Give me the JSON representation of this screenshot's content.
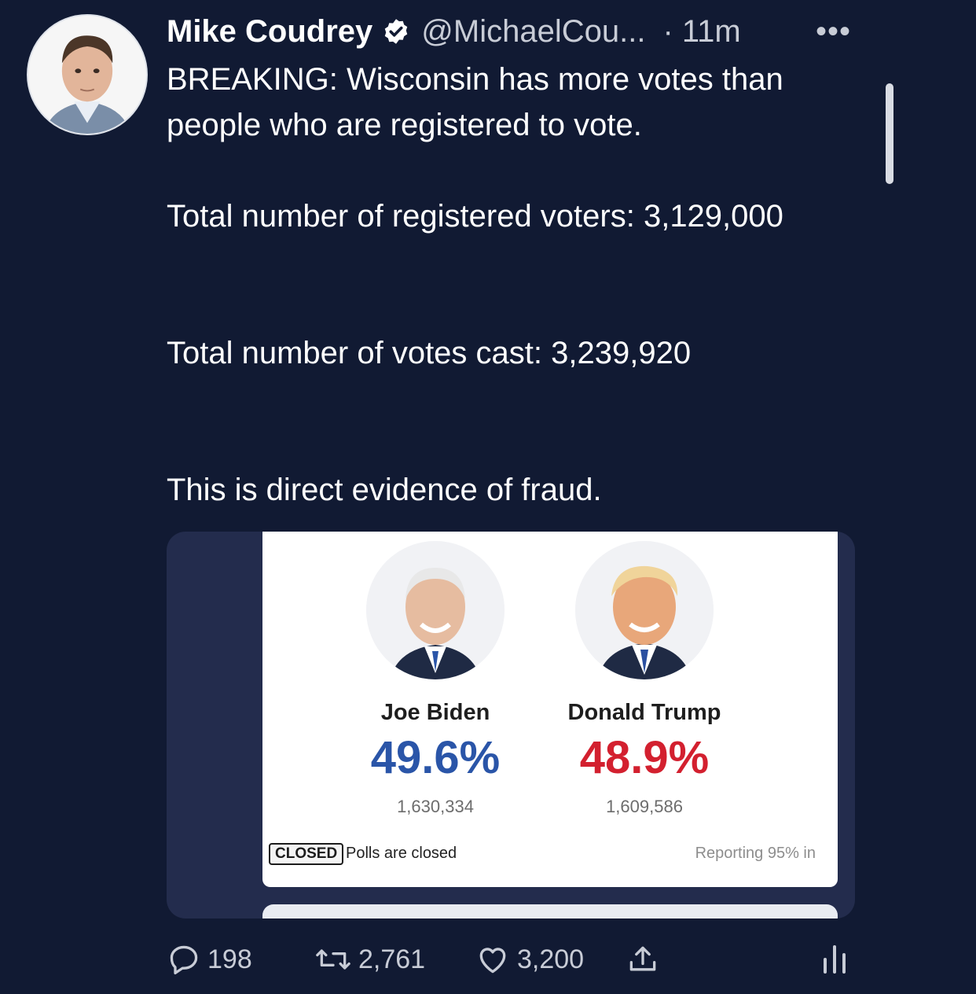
{
  "tweet": {
    "author": {
      "display_name": "Mike Coudrey",
      "handle": "@MichaelCou...",
      "verified_icon": "verified-badge-icon",
      "avatar": "avatar"
    },
    "time": "· 11m",
    "more_label": "•••",
    "text_lines": {
      "p1": "BREAKING: Wisconsin has more votes than people who are registered to vote.",
      "p2": "Total number of registered voters: 3,129,000",
      "p3": "Total number of votes cast: 3,239,920",
      "p4": "This is direct evidence of fraud."
    }
  },
  "embedded_card": {
    "candidates": [
      {
        "name": "Joe Biden",
        "percent": "49.6%",
        "votes": "1,630,334",
        "color": "#2a55a8"
      },
      {
        "name": "Donald Trump",
        "percent": "48.9%",
        "votes": "1,609,586",
        "color": "#d3202f"
      }
    ],
    "status_badge": "CLOSED",
    "status_text": "Polls are closed",
    "reporting": "Reporting 95% in"
  },
  "actions": {
    "reply_count": "198",
    "retweet_count": "2,761",
    "like_count": "3,200",
    "icons": [
      "reply-icon",
      "retweet-icon",
      "like-icon",
      "share-icon",
      "analytics-icon"
    ]
  },
  "colors": {
    "background": "#111a33",
    "text_secondary": "#c8ccd6"
  }
}
